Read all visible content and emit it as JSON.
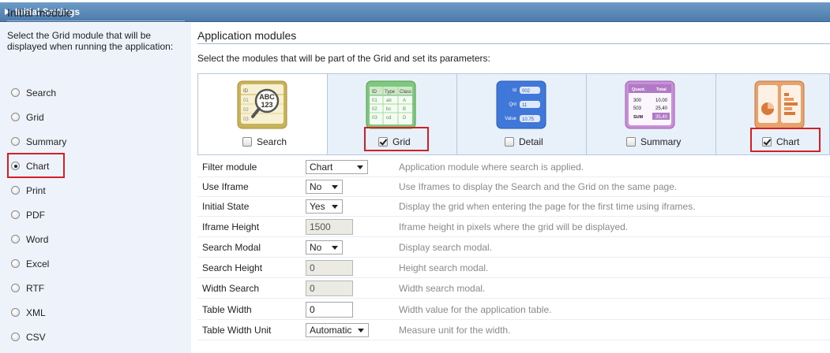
{
  "titlebar": {
    "title": "Initial Settings"
  },
  "left": {
    "title": "Initial module",
    "description": "Select the Grid module that will be displayed when running the application:",
    "options": [
      "Search",
      "Grid",
      "Summary",
      "Chart",
      "Print",
      "PDF",
      "Word",
      "Excel",
      "RTF",
      "XML",
      "CSV"
    ],
    "selected": "Chart"
  },
  "right": {
    "title": "Application modules",
    "description": "Select the modules that will be part of the Grid and set its parameters:",
    "modules": [
      {
        "label": "Search",
        "checked": false
      },
      {
        "label": "Grid",
        "checked": true
      },
      {
        "label": "Detail",
        "checked": false
      },
      {
        "label": "Summary",
        "checked": false
      },
      {
        "label": "Chart",
        "checked": true
      }
    ],
    "icon_text": {
      "search": {
        "id": "ID",
        "abc": "ABC",
        "n123": "123",
        "rows": [
          "01",
          "02",
          "03"
        ]
      },
      "grid": {
        "headers": [
          "ID",
          "Type",
          "Class"
        ],
        "rows": [
          [
            "01",
            "ab",
            "A"
          ],
          [
            "02",
            "bc",
            "B"
          ],
          [
            "03",
            "cd",
            "D"
          ]
        ]
      },
      "detail": {
        "rows": [
          [
            "Id",
            "002"
          ],
          [
            "Qnt",
            "11"
          ],
          [
            "Value",
            "10.75"
          ]
        ]
      },
      "summary": {
        "headers": [
          "Quant.",
          "Total"
        ],
        "rows": [
          [
            "300",
            "10,00"
          ],
          [
            "503",
            "25,40"
          ],
          [
            "SUM",
            "35,40"
          ]
        ]
      }
    }
  },
  "settings": [
    {
      "label": "Filter module",
      "type": "select",
      "value": "Chart",
      "description": "Application module where search is applied."
    },
    {
      "label": "Use Iframe",
      "type": "select",
      "value": "No",
      "description": "Use Iframes to display the Search and the Grid on the same page."
    },
    {
      "label": "Initial State",
      "type": "select",
      "value": "Yes",
      "description": "Display the grid when entering the page for the first time using iframes."
    },
    {
      "label": "Iframe Height",
      "type": "input-disabled",
      "value": "1500",
      "description": "Iframe height in pixels where the grid will be displayed."
    },
    {
      "label": "Search Modal",
      "type": "select",
      "value": "No",
      "description": "Display search modal."
    },
    {
      "label": "Search Height",
      "type": "input-disabled",
      "value": "0",
      "description": "Height search modal."
    },
    {
      "label": "Width Search",
      "type": "input-disabled",
      "value": "0",
      "description": "Width search modal."
    },
    {
      "label": "Table Width",
      "type": "input",
      "value": "0",
      "description": "Width value for the application table."
    },
    {
      "label": "Table Width Unit",
      "type": "select",
      "value": "Automatic",
      "description": "Measure unit for the width."
    }
  ],
  "colors": {
    "titlebar": "#5a88b8",
    "highlight": "#d32027",
    "panel": "#eef3fb"
  }
}
